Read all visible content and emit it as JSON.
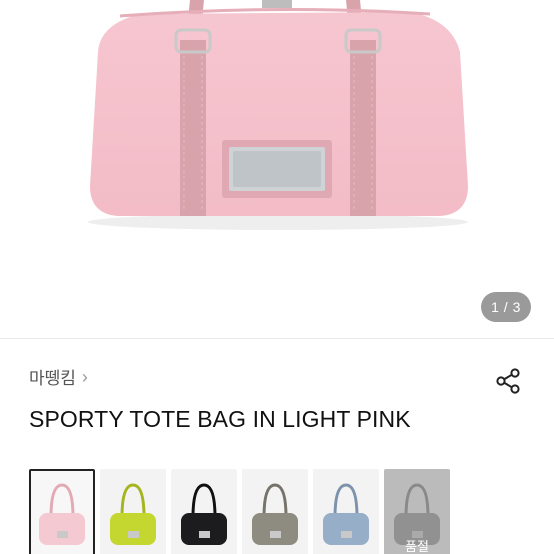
{
  "gallery": {
    "page_indicator": "1 / 3",
    "bag_color": "#f6c6d0",
    "strap_color": "#d9a3ac"
  },
  "brand": {
    "name": "마뗑킴",
    "chevron": "›"
  },
  "product": {
    "title": "SPORTY TOTE BAG IN LIGHT PINK"
  },
  "share_icon": "share-icon",
  "colors": [
    {
      "color": "#f5c9d2",
      "strap": "#e3aab4",
      "selected": true,
      "sold_out": false
    },
    {
      "color": "#c4d630",
      "strap": "#a6b51e",
      "selected": false,
      "sold_out": false
    },
    {
      "color": "#1c1c1e",
      "strap": "#111111",
      "selected": false,
      "sold_out": false
    },
    {
      "color": "#8e8b80",
      "strap": "#76736a",
      "selected": false,
      "sold_out": false
    },
    {
      "color": "#97aec8",
      "strap": "#7e93ab",
      "selected": false,
      "sold_out": false
    },
    {
      "color": "#8a8a8a",
      "strap": "#777777",
      "selected": false,
      "sold_out": true,
      "sold_out_label": "품절"
    }
  ]
}
